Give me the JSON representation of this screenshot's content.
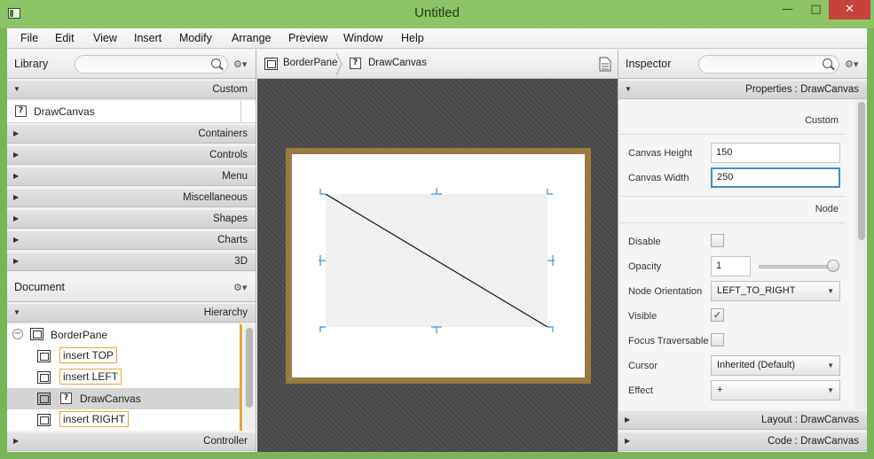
{
  "window": {
    "title": "Untitled",
    "minimize": "—",
    "maximize": "□",
    "close": "✕"
  },
  "menu": [
    "File",
    "Edit",
    "View",
    "Insert",
    "Modify",
    "Arrange",
    "Preview",
    "Window",
    "Help"
  ],
  "library": {
    "title": "Library",
    "search_placeholder": "",
    "custom_section": "Custom",
    "custom_item": "DrawCanvas",
    "sections": [
      "Containers",
      "Controls",
      "Menu",
      "Miscellaneous",
      "Shapes",
      "Charts",
      "3D"
    ]
  },
  "document": {
    "title": "Document",
    "hierarchy_section": "Hierarchy",
    "tree": {
      "root": "BorderPane",
      "children": [
        {
          "label": "insert TOP",
          "kind": "placeholder"
        },
        {
          "label": "insert LEFT",
          "kind": "placeholder"
        },
        {
          "label": "DrawCanvas",
          "kind": "node",
          "selected": true
        },
        {
          "label": "insert RIGHT",
          "kind": "placeholder"
        }
      ]
    },
    "controller_section": "Controller"
  },
  "breadcrumb": [
    "BorderPane",
    "DrawCanvas"
  ],
  "inspector": {
    "title": "Inspector",
    "properties_header": "Properties : DrawCanvas",
    "custom_group": "Custom",
    "canvas_height_label": "Canvas Height",
    "canvas_height": "150",
    "canvas_width_label": "Canvas Width",
    "canvas_width": "250",
    "node_group": "Node",
    "disable_label": "Disable",
    "disable_checked": false,
    "opacity_label": "Opacity",
    "opacity": "1",
    "opacity_slider_value": 1.0,
    "node_orientation_label": "Node Orientation",
    "node_orientation": "LEFT_TO_RIGHT",
    "visible_label": "Visible",
    "visible_checked": true,
    "focus_traversable_label": "Focus Traversable",
    "focus_traversable_checked": false,
    "cursor_label": "Cursor",
    "cursor": "Inherited (Default)",
    "effect_label": "Effect",
    "effect": "+",
    "layout_header": "Layout : DrawCanvas",
    "code_header": "Code : DrawCanvas"
  },
  "colors": {
    "titlebar": "#8dc468",
    "close_button": "#c7423a",
    "placeholder_outline": "#e7a535",
    "frame_border": "#9a7a3e",
    "selection_handles": "#3d8fd1",
    "focus_border": "#3d8fd1"
  },
  "icons": {
    "search": "search-icon",
    "gear": "gear-icon",
    "node": "node-icon",
    "unknown_type": "question-icon",
    "document": "document-icon",
    "collapse": "collapse-icon"
  }
}
